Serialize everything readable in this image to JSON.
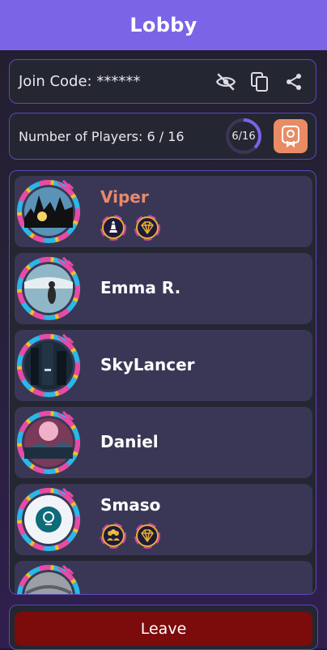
{
  "header": {
    "title": "Lobby"
  },
  "join": {
    "label": "Join Code: ******",
    "hide_icon": "eye-off-icon",
    "copy_icon": "copy-icon",
    "share_icon": "share-icon"
  },
  "players": {
    "label": "Number of Players: 6 / 16",
    "ring_label": "6/16",
    "current": 6,
    "max": 16,
    "award_icon": "award-icon"
  },
  "list": {
    "items": [
      {
        "name": "Viper",
        "host": true,
        "badges": [
          "chess-icon",
          "diamond-icon"
        ]
      },
      {
        "name": "Emma R.",
        "host": false,
        "badges": []
      },
      {
        "name": "SkyLancer",
        "host": false,
        "badges": []
      },
      {
        "name": "Daniel",
        "host": false,
        "badges": []
      },
      {
        "name": "Smaso",
        "host": false,
        "badges": [
          "group-icon",
          "diamond-icon"
        ]
      },
      {
        "name": "",
        "host": false,
        "badges": []
      }
    ]
  },
  "footer": {
    "leave_label": "Leave"
  },
  "colors": {
    "header": "#7b64e6",
    "accent_border": "#5a4ab8",
    "host_name": "#e9896b",
    "award_bg": "#e98c66",
    "leave_bg": "#7c0b0b"
  }
}
